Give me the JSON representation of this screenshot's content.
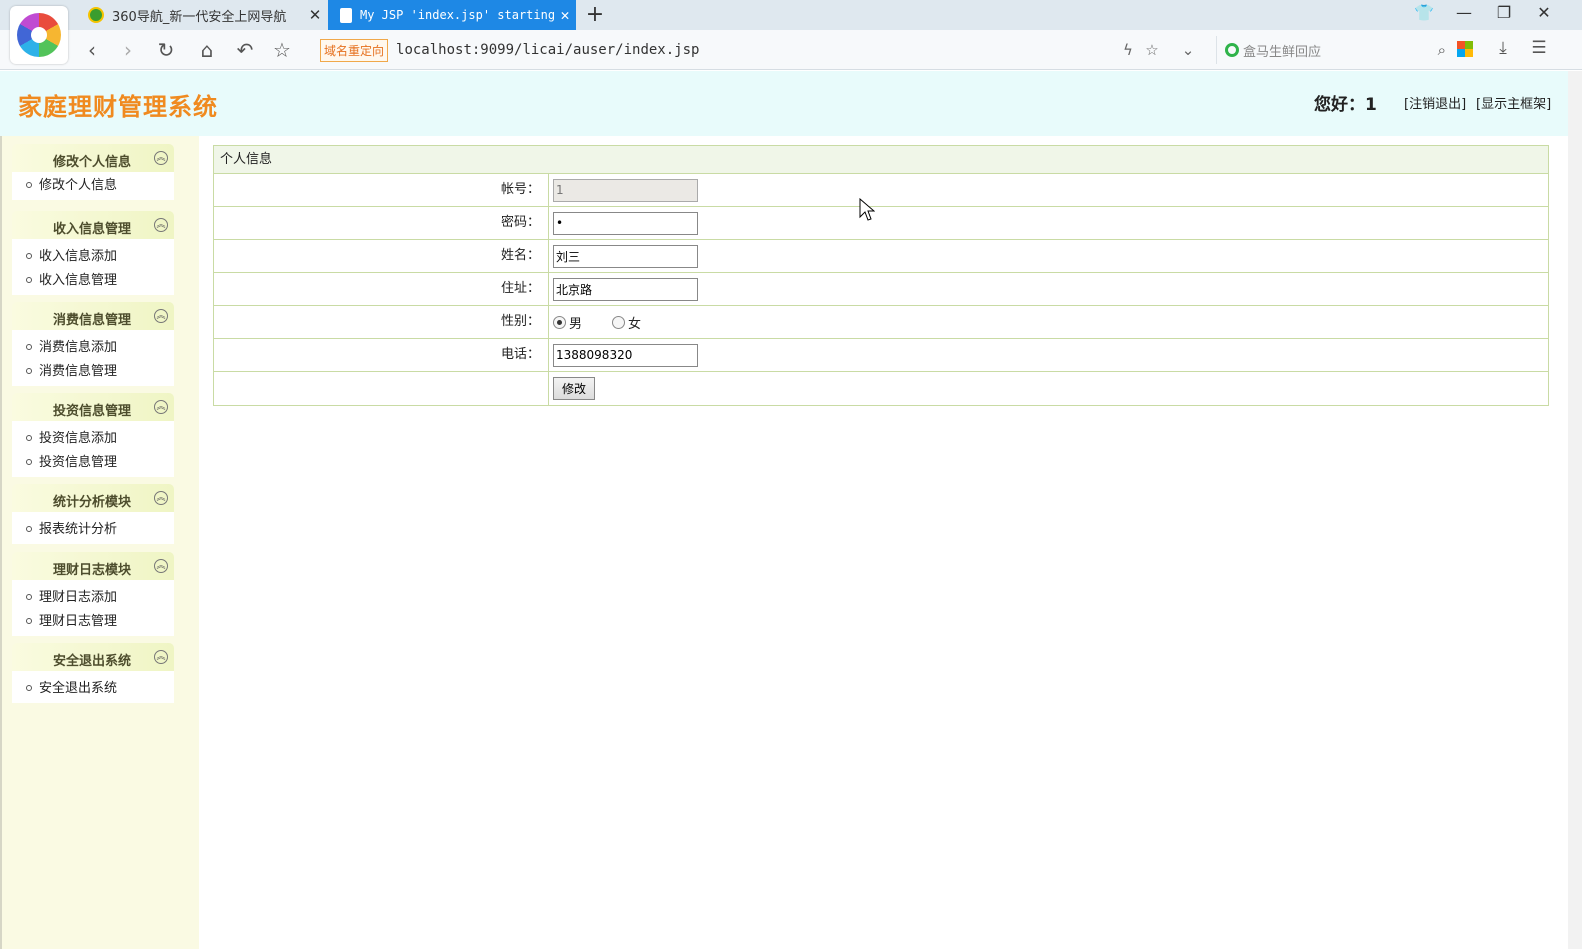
{
  "browser": {
    "tabs": [
      {
        "label": "360导航_新一代安全上网导航",
        "active": false
      },
      {
        "label": "My JSP 'index.jsp' starting",
        "active": true
      }
    ],
    "new_tab": "+",
    "redirect_badge": "域名重定向",
    "url": "localhost:9099/licai/auser/index.jsp",
    "search_placeholder": "盒马生鲜回应"
  },
  "header": {
    "title": "家庭理财管理系统",
    "greeting": "您好：1",
    "logout": "[注销退出]",
    "show_frame": "[显示主框架]"
  },
  "sidebar": {
    "groups": [
      {
        "title": "修改个人信息",
        "items": [
          "修改个人信息"
        ]
      },
      {
        "title": "收入信息管理",
        "items": [
          "收入信息添加",
          "收入信息管理"
        ]
      },
      {
        "title": "消费信息管理",
        "items": [
          "消费信息添加",
          "消费信息管理"
        ]
      },
      {
        "title": "投资信息管理",
        "items": [
          "投资信息添加",
          "投资信息管理"
        ]
      },
      {
        "title": "统计分析模块",
        "items": [
          "报表统计分析"
        ]
      },
      {
        "title": "理财日志模块",
        "items": [
          "理财日志添加",
          "理财日志管理"
        ]
      },
      {
        "title": "安全退出系统",
        "items": [
          "安全退出系统"
        ]
      }
    ],
    "toggle_glyph": "︽"
  },
  "form": {
    "title": "个人信息",
    "account_label": "帐号：",
    "account_value": "1",
    "password_label": "密码：",
    "password_value": "1",
    "name_label": "姓名：",
    "name_value": "刘三",
    "address_label": "住址：",
    "address_value": "北京路",
    "gender_label": "性别：",
    "gender_male": "男",
    "gender_female": "女",
    "gender_selected": "男",
    "phone_label": "电话：",
    "phone_value": "1388098320",
    "submit_label": "修改"
  },
  "colors": {
    "title": "#f08a1f",
    "header_bg": "#e8fbfb",
    "sidebar_bg": "#fafae3",
    "tab_active": "#1e88e5",
    "table_border": "#c9dba4"
  }
}
